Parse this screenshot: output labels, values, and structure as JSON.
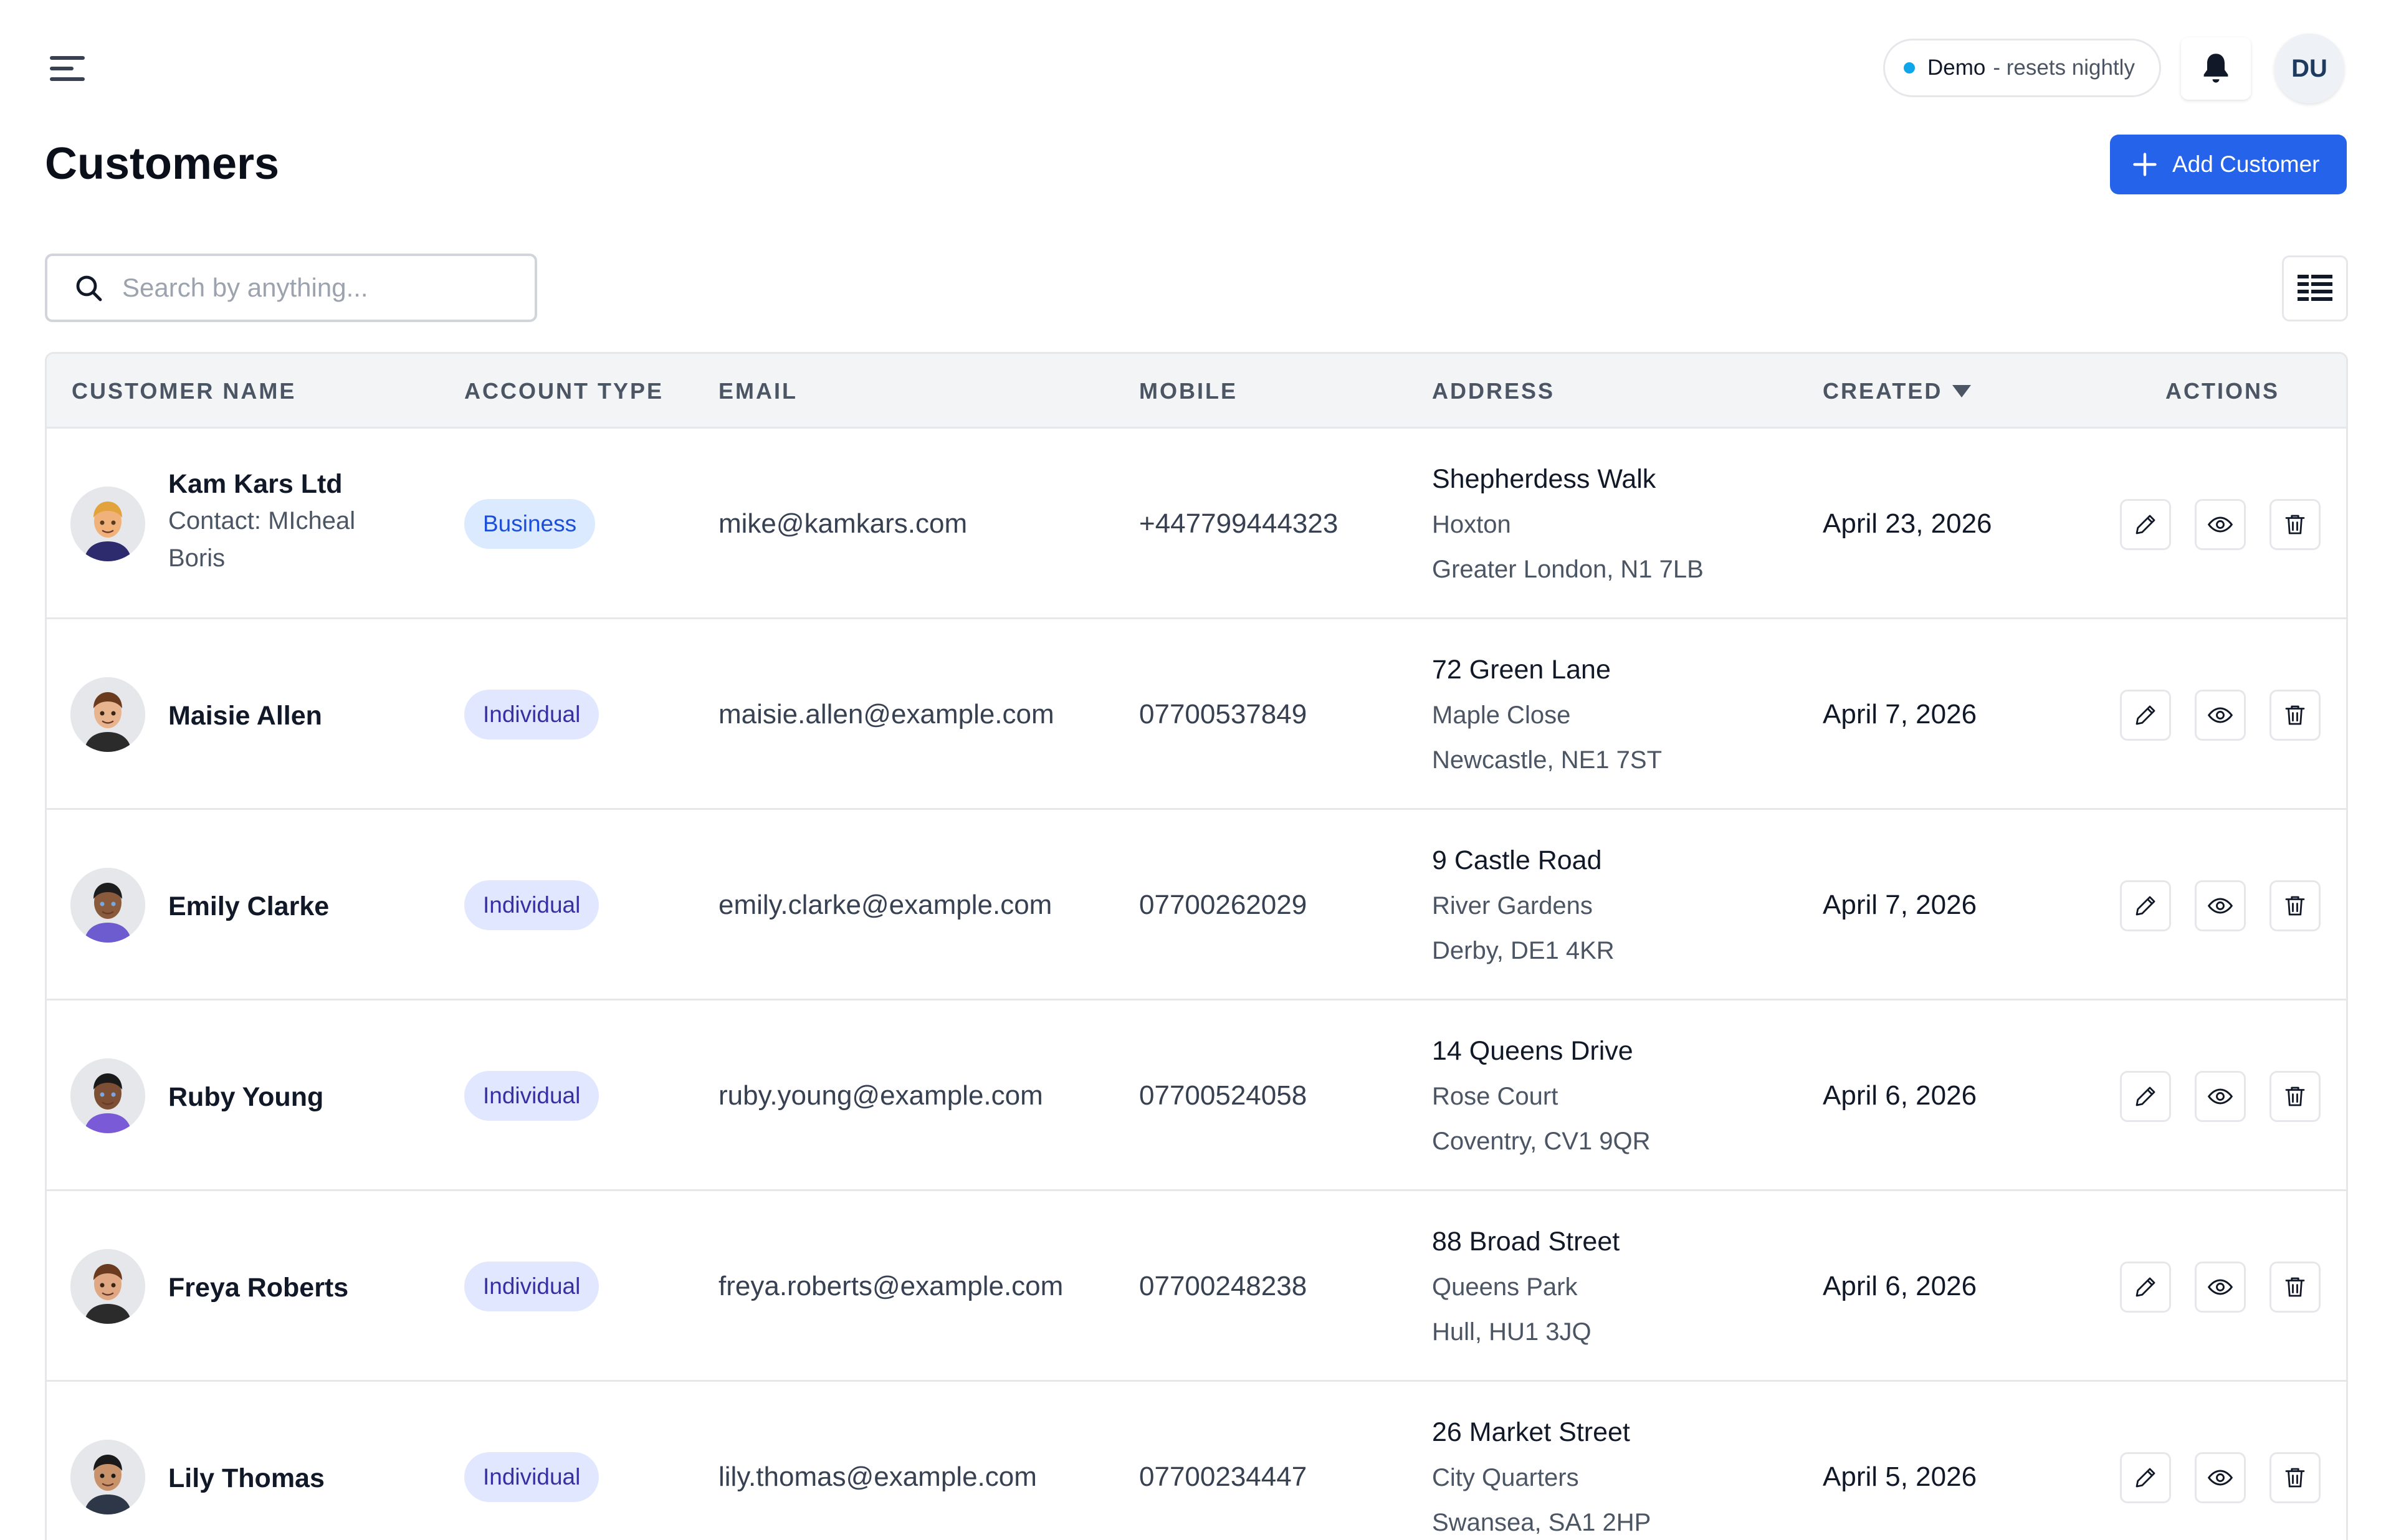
{
  "header": {
    "demo_label": "Demo",
    "demo_note": "- resets nightly",
    "user_initials": "DU"
  },
  "page": {
    "title": "Customers",
    "add_button_label": "Add Customer"
  },
  "search": {
    "placeholder": "Search by anything...",
    "value": ""
  },
  "table": {
    "columns": [
      "CUSTOMER NAME",
      "ACCOUNT TYPE",
      "EMAIL",
      "MOBILE",
      "ADDRESS",
      "CREATED",
      "ACTIONS"
    ],
    "sorted_column": "CREATED",
    "sort_direction": "desc",
    "rows": [
      {
        "name": "Kam Kars Ltd",
        "contact": "Contact: MIcheal Boris",
        "account_type": "Business",
        "email": "mike@kamkars.com",
        "mobile": "+447799444323",
        "address_line1": "Shepherdess Walk",
        "address_line2": "Hoxton",
        "address_line3": "Greater London, N1 7LB",
        "created": "April 23, 2026"
      },
      {
        "name": "Maisie Allen",
        "contact": "",
        "account_type": "Individual",
        "email": "maisie.allen@example.com",
        "mobile": "07700537849",
        "address_line1": "72 Green Lane",
        "address_line2": "Maple Close",
        "address_line3": "Newcastle, NE1 7ST",
        "created": "April 7, 2026"
      },
      {
        "name": "Emily Clarke",
        "contact": "",
        "account_type": "Individual",
        "email": "emily.clarke@example.com",
        "mobile": "07700262029",
        "address_line1": "9 Castle Road",
        "address_line2": "River Gardens",
        "address_line3": "Derby, DE1 4KR",
        "created": "April 7, 2026"
      },
      {
        "name": "Ruby Young",
        "contact": "",
        "account_type": "Individual",
        "email": "ruby.young@example.com",
        "mobile": "07700524058",
        "address_line1": "14 Queens Drive",
        "address_line2": "Rose Court",
        "address_line3": "Coventry, CV1 9QR",
        "created": "April 6, 2026"
      },
      {
        "name": "Freya Roberts",
        "contact": "",
        "account_type": "Individual",
        "email": "freya.roberts@example.com",
        "mobile": "07700248238",
        "address_line1": "88 Broad Street",
        "address_line2": "Queens Park",
        "address_line3": "Hull, HU1 3JQ",
        "created": "April 6, 2026"
      },
      {
        "name": "Lily Thomas",
        "contact": "",
        "account_type": "Individual",
        "email": "lily.thomas@example.com",
        "mobile": "07700234447",
        "address_line1": "26 Market Street",
        "address_line2": "City Quarters",
        "address_line3": "Swansea, SA1 2HP",
        "created": "April 5, 2026"
      }
    ]
  },
  "colors": {
    "primary": "#2563eb",
    "business_badge_bg": "#dbeafe",
    "business_badge_text": "#1d4ed8",
    "individual_badge_bg": "#e0e7ff",
    "individual_badge_text": "#3730a3",
    "demo_dot": "#0ea5e9",
    "header_bg": "#f3f4f6"
  },
  "icons": {
    "menu": "menu-icon",
    "bell": "bell-icon",
    "plus": "plus-icon",
    "search": "search-icon",
    "columns": "columns-icon",
    "sort": "sort-desc-icon",
    "edit": "pencil-icon",
    "view": "eye-icon",
    "delete": "trash-icon"
  }
}
